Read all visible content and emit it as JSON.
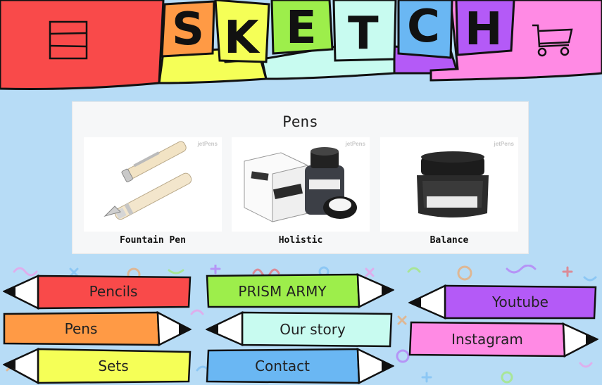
{
  "header": {
    "letters": [
      "S",
      "K",
      "E",
      "T",
      "C",
      "H"
    ],
    "menu_icon": "hamburger-menu-icon",
    "cart_icon": "shopping-cart-icon"
  },
  "colors": {
    "red": "#f94a4a",
    "orange": "#ff9a45",
    "yellow": "#f5ff57",
    "green": "#9dee4b",
    "mint": "#c8fbf0",
    "blue": "#6ab7f3",
    "purple": "#b45af7",
    "pink": "#ff8ae4",
    "background": "#b7dcf6"
  },
  "products": {
    "title": "Pens",
    "watermark": "jetPens",
    "items": [
      {
        "name": "Fountain Pen"
      },
      {
        "name": "Holistic"
      },
      {
        "name": "Balance"
      }
    ]
  },
  "nav": {
    "pencils": "Pencils",
    "pens": "Pens",
    "sets": "Sets",
    "prism_army": "PRISM ARMY",
    "our_story": "Our story",
    "contact": "Contact",
    "youtube": "Youtube",
    "instagram": "Instagram"
  }
}
